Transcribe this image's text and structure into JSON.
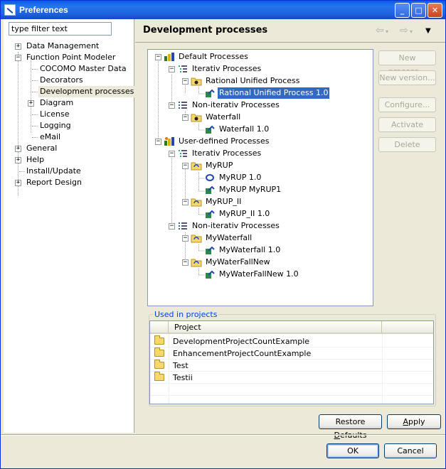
{
  "window": {
    "title": "Preferences"
  },
  "filter": {
    "placeholder": "type filter text",
    "value": "type filter text"
  },
  "nav": {
    "items": [
      {
        "label": "Data Management"
      },
      {
        "label": "Function Point Modeler"
      },
      {
        "label": "COCOMO Master Data"
      },
      {
        "label": "Decorators"
      },
      {
        "label": "Development processes"
      },
      {
        "label": "Diagram"
      },
      {
        "label": "License"
      },
      {
        "label": "Logging"
      },
      {
        "label": "eMail"
      },
      {
        "label": "General"
      },
      {
        "label": "Help"
      },
      {
        "label": "Install/Update"
      },
      {
        "label": "Report Design"
      }
    ]
  },
  "page": {
    "title": "Development processes"
  },
  "tree": {
    "nodes": [
      {
        "label": "Default Processes"
      },
      {
        "label": "Iterativ Processes"
      },
      {
        "label": "Rational Unified Process"
      },
      {
        "label": "Rational Unified Process 1.0"
      },
      {
        "label": "Non-iterativ Processes"
      },
      {
        "label": "Waterfall"
      },
      {
        "label": "Waterfall 1.0"
      },
      {
        "label": "User-defined Processes"
      },
      {
        "label": "Iterativ Processes"
      },
      {
        "label": "MyRUP"
      },
      {
        "label": "MyRUP 1.0"
      },
      {
        "label": "MyRUP MyRUP1"
      },
      {
        "label": "MyRUP_II"
      },
      {
        "label": "MyRUP_II 1.0"
      },
      {
        "label": "Non-iterativ Processes"
      },
      {
        "label": "MyWaterfall"
      },
      {
        "label": "MyWaterfall 1.0"
      },
      {
        "label": "MyWaterFallNew"
      },
      {
        "label": "MyWaterFallNew 1.0"
      }
    ]
  },
  "side_buttons": {
    "new_process": "New process...",
    "new_version": "New version...",
    "configure": "Configure...",
    "activate": "Activate",
    "delete": "Delete"
  },
  "projects": {
    "group_title": "Used in projects",
    "column_header": "Project",
    "rows": [
      {
        "name": "DevelopmentProjectCountExample"
      },
      {
        "name": "EnhancementProjectCountExample"
      },
      {
        "name": "Test"
      },
      {
        "name": "Testii"
      }
    ]
  },
  "buttons": {
    "restore_defaults_pre": "Restore ",
    "restore_defaults_ul": "D",
    "restore_defaults_post": "efaults",
    "apply_ul": "A",
    "apply_post": "pply",
    "ok": "OK",
    "cancel": "Cancel"
  },
  "colors": {
    "selection": "#316ac5",
    "group_title": "#0046d5"
  }
}
